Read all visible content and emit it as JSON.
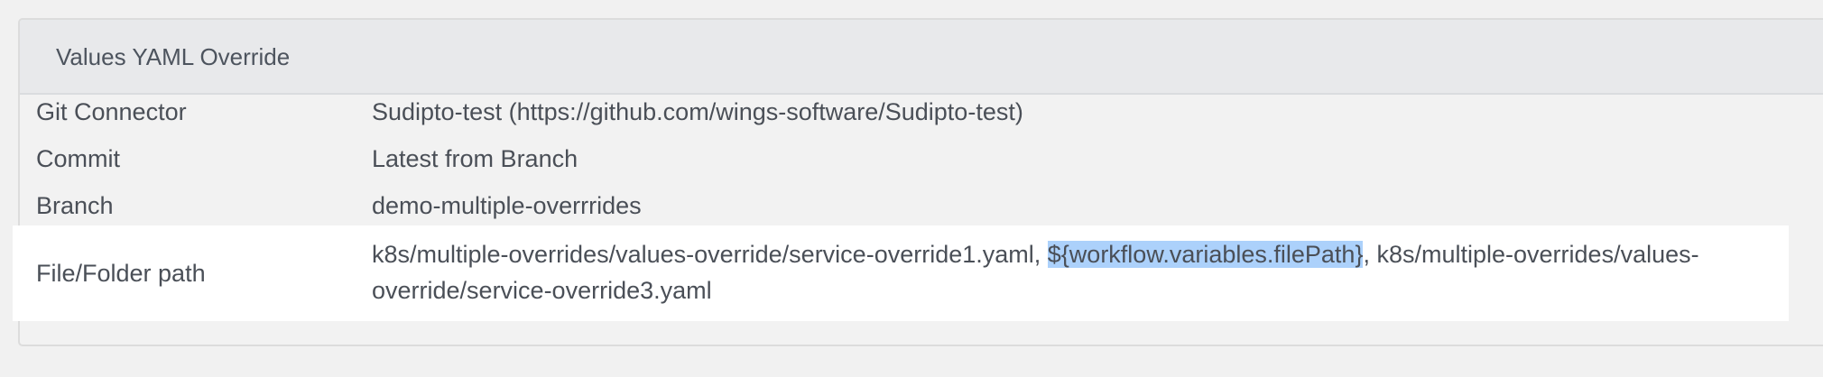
{
  "panel": {
    "title": "Values YAML Override"
  },
  "rows": {
    "git_connector": {
      "label": "Git Connector",
      "value": "Sudipto-test (https://github.com/wings-software/Sudipto-test)"
    },
    "commit": {
      "label": "Commit",
      "value": "Latest from Branch"
    },
    "branch": {
      "label": "Branch",
      "value": "demo-multiple-overrrides"
    },
    "file_path": {
      "label": "File/Folder path",
      "part1": "k8s/multiple-overrides/values-override/service-override1.yaml, ",
      "highlight": "${workflow.variables.filePath}",
      "part2": ", k8s/multiple-overrides/values-override/service-override3.yaml"
    }
  },
  "colors": {
    "link": "#1a8ae3",
    "selection": "#acd1fb",
    "header_bg": "#e8e9eb",
    "page_bg": "#f1f1f1"
  }
}
